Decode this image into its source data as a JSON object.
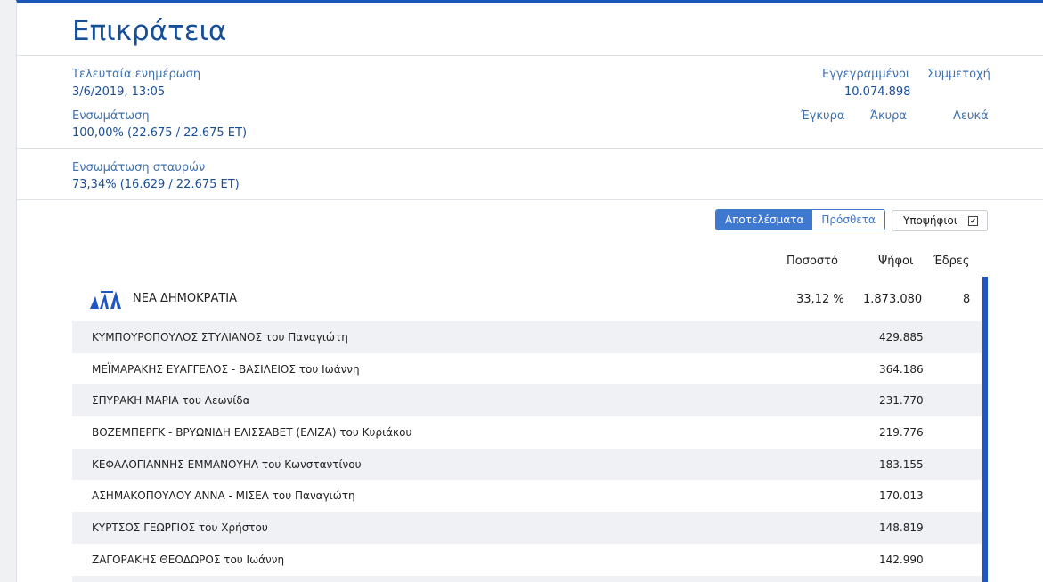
{
  "header": {
    "title": "Επικράτεια"
  },
  "info": {
    "last_update_label": "Τελευταία ενημέρωση",
    "last_update_value": "3/6/2019, 13:05",
    "integration_label": "Ενσωμάτωση",
    "integration_value": "100,00% (22.675 / 22.675 ΕΤ)",
    "registered_label": "Εγγεγραμμένοι",
    "registered_value": "10.074.898",
    "participation_label": "Συμμετοχή",
    "valid_label": "Έγκυρα",
    "invalid_label": "Άκυρα",
    "blank_label": "Λευκά",
    "cross_integration_label": "Ενσωμάτωση σταυρών",
    "cross_integration_value": "73,34% (16.629 / 22.675 ΕΤ)"
  },
  "toolbar": {
    "results_label": "Αποτελέσματα",
    "additional_label": "Πρόσθετα",
    "candidates_label": "Υποψήφιοι",
    "candidates_checked": true
  },
  "columns": {
    "percent": "Ποσοστό",
    "votes": "Ψήφοι",
    "seats": "Έδρες"
  },
  "party": {
    "name": "ΝΕΑ ΔΗΜΟΚΡΑΤΙΑ",
    "percent": "33,12 %",
    "votes": "1.873.080",
    "seats": "8",
    "color": "#1f56c4",
    "logo": "nd-logo-icon"
  },
  "candidates": [
    {
      "name": "ΚΥΜΠΟΥΡΟΠΟΥΛΟΣ ΣΤΥΛΙΑΝΟΣ του Παναγιώτη",
      "votes": "429.885"
    },
    {
      "name": "ΜΕΪΜΑΡΑΚΗΣ ΕΥΑΓΓΕΛΟΣ - ΒΑΣΙΛΕΙΟΣ του Ιωάννη",
      "votes": "364.186"
    },
    {
      "name": "ΣΠΥΡΑΚΗ ΜΑΡΙΑ του Λεωνίδα",
      "votes": "231.770"
    },
    {
      "name": "ΒΟΖΕΜΠΕΡΓΚ - ΒΡΥΩΝΙΔΗ ΕΛΙΣΣΑΒΕΤ (ΕΛΙΖΑ) του Κυριάκου",
      "votes": "219.776"
    },
    {
      "name": "ΚΕΦΑΛΟΓΙΑΝΝΗΣ ΕΜΜΑΝΟΥΗΛ του Κωνσταντίνου",
      "votes": "183.155"
    },
    {
      "name": "ΑΣΗΜΑΚΟΠΟΥΛΟΥ ΑΝΝΑ - ΜΙΣΕΛ του Παναγιώτη",
      "votes": "170.013"
    },
    {
      "name": "ΚΥΡΤΣΟΣ ΓΕΩΡΓΙΟΣ του Χρήστου",
      "votes": "148.819"
    },
    {
      "name": "ΖΑΓΟΡΑΚΗΣ ΘΕΟΔΩΡΟΣ του Ιωάννη",
      "votes": "142.990"
    }
  ]
}
